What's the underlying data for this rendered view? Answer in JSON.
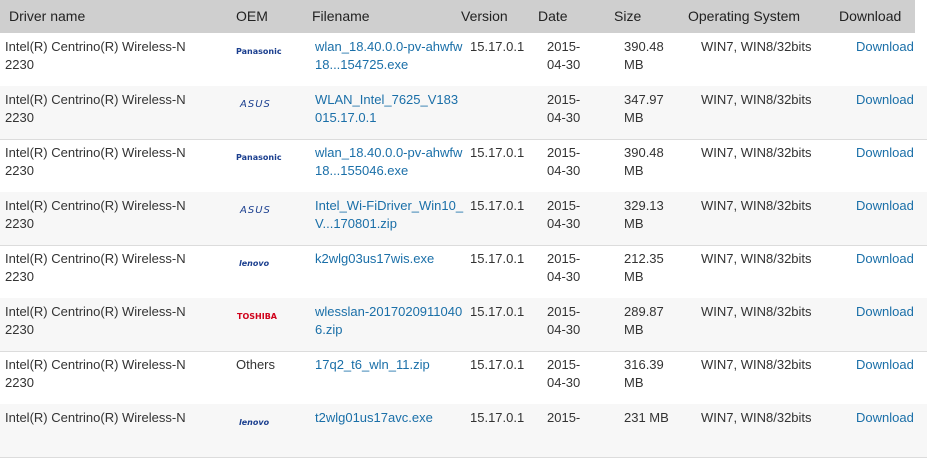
{
  "header": {
    "driver_name": "Driver name",
    "oem": "OEM",
    "filename": "Filename",
    "version": "Version",
    "date": "Date",
    "size": "Size",
    "os": "Operating System",
    "download": "Download"
  },
  "rows": [
    {
      "name": "Intel(R) Centrino(R) Wireless-N 2230",
      "oem": "Panasonic",
      "oem_type": "logo",
      "oem_class": "panasonic",
      "file": "wlan_18.40.0.0-pv-ahwfw18...154725.exe",
      "version": "15.17.0.1",
      "date": "2015-04-30",
      "size": "390.48 MB",
      "os": "WIN7, WIN8/32bits",
      "download": "Download"
    },
    {
      "name": "Intel(R) Centrino(R) Wireless-N 2230",
      "oem": "ASUS",
      "oem_type": "logo",
      "oem_class": "asus",
      "file": "WLAN_Intel_7625_V183015.17.0.1",
      "version": "",
      "date": "2015-04-30",
      "size": "347.97 MB",
      "os": "WIN7, WIN8/32bits",
      "download": "Download"
    },
    {
      "name": "Intel(R) Centrino(R) Wireless-N 2230",
      "oem": "Panasonic",
      "oem_type": "logo",
      "oem_class": "panasonic",
      "file": "wlan_18.40.0.0-pv-ahwfw18...155046.exe",
      "version": "15.17.0.1",
      "date": "2015-04-30",
      "size": "390.48 MB",
      "os": "WIN7, WIN8/32bits",
      "download": "Download"
    },
    {
      "name": "Intel(R) Centrino(R) Wireless-N 2230",
      "oem": "ASUS",
      "oem_type": "logo",
      "oem_class": "asus",
      "file": "Intel_Wi-FiDriver_Win10_V...170801.zip",
      "version": "15.17.0.1",
      "date": "2015-04-30",
      "size": "329.13 MB",
      "os": "WIN7, WIN8/32bits",
      "download": "Download"
    },
    {
      "name": "Intel(R) Centrino(R) Wireless-N 2230",
      "oem": "lenovo",
      "oem_type": "logo",
      "oem_class": "lenovo",
      "file": "k2wlg03us17wis.exe",
      "version": "15.17.0.1",
      "date": "2015-04-30",
      "size": "212.35 MB",
      "os": "WIN7, WIN8/32bits",
      "download": "Download"
    },
    {
      "name": "Intel(R) Centrino(R) Wireless-N 2230",
      "oem": "TOSHIBA",
      "oem_type": "logo",
      "oem_class": "toshiba",
      "file": "wlesslan-20170209110406.zip",
      "version": "15.17.0.1",
      "date": "2015-04-30",
      "size": "289.87 MB",
      "os": "WIN7, WIN8/32bits",
      "download": "Download"
    },
    {
      "name": "Intel(R) Centrino(R) Wireless-N 2230",
      "oem": "Others",
      "oem_type": "text",
      "oem_class": "text",
      "file": "17q2_t6_wln_11.zip",
      "version": "15.17.0.1",
      "date": "2015-04-30",
      "size": "316.39 MB",
      "os": "WIN7, WIN8/32bits",
      "download": "Download"
    },
    {
      "name": "Intel(R) Centrino(R) Wireless-N",
      "oem": "lenovo",
      "oem_type": "logo",
      "oem_class": "lenovo",
      "file": "t2wlg01us17avc.exe",
      "version": "15.17.0.1",
      "date": "2015-",
      "size": "231 MB",
      "os": "WIN7, WIN8/32bits",
      "download": "Download"
    }
  ]
}
